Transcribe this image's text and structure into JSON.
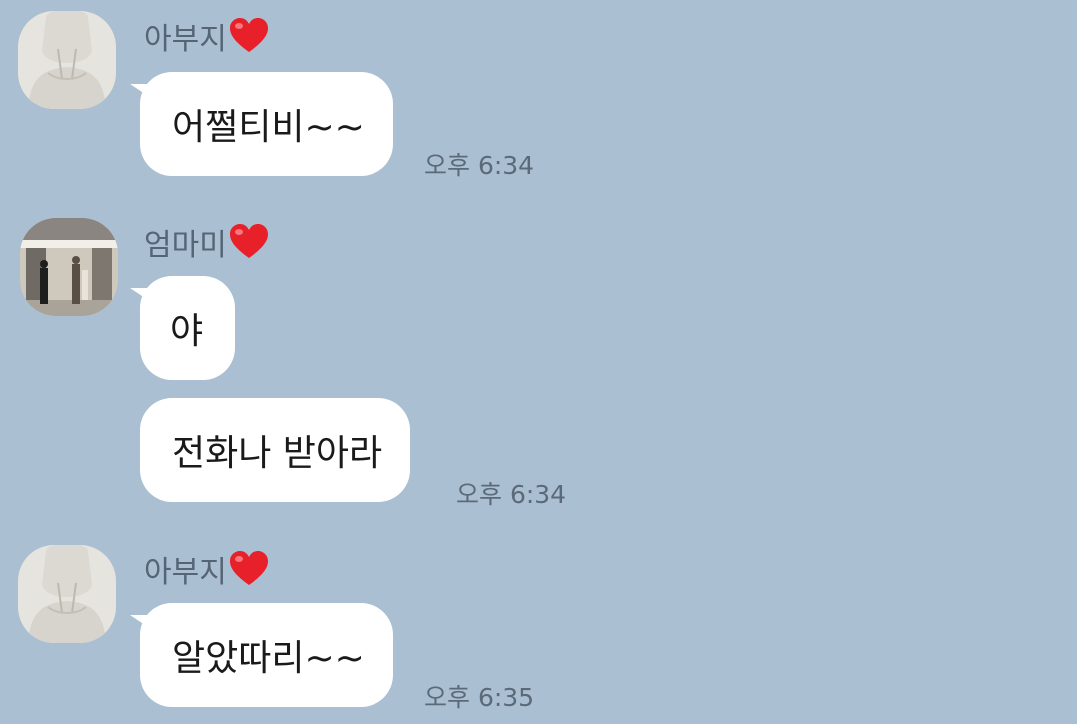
{
  "chat": {
    "messages": [
      {
        "sender": "아부지",
        "avatar": "hoodie-person-avatar",
        "bubbles": [
          "어쩔티비~~"
        ],
        "time": "오후 6:34"
      },
      {
        "sender": "엄마미",
        "avatar": "store-photo-avatar",
        "bubbles": [
          "야",
          "전화나 받아라"
        ],
        "time": "오후 6:34"
      },
      {
        "sender": "아부지",
        "avatar": "hoodie-person-avatar",
        "bubbles": [
          "알았따리~~"
        ],
        "time": "오후 6:35"
      }
    ]
  },
  "colors": {
    "background": "#abbfd2",
    "bubble": "#ffffff",
    "heart": "#e8202a"
  }
}
